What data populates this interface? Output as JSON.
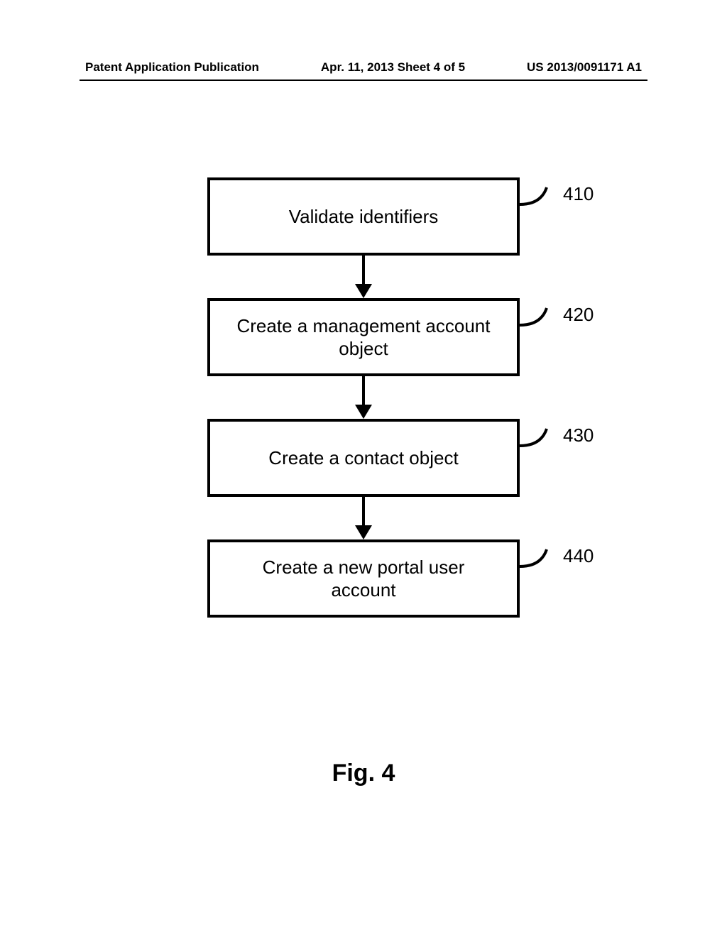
{
  "header": {
    "left": "Patent Application Publication",
    "center": "Apr. 11, 2013  Sheet 4 of 5",
    "right": "US 2013/0091171 A1"
  },
  "flowchart": {
    "steps": [
      {
        "label": "Validate identifiers",
        "ref": "410"
      },
      {
        "label": "Create a management account object",
        "ref": "420"
      },
      {
        "label": "Create a contact object",
        "ref": "430"
      },
      {
        "label": "Create a new portal user account",
        "ref": "440"
      }
    ]
  },
  "figure_label": "Fig. 4"
}
